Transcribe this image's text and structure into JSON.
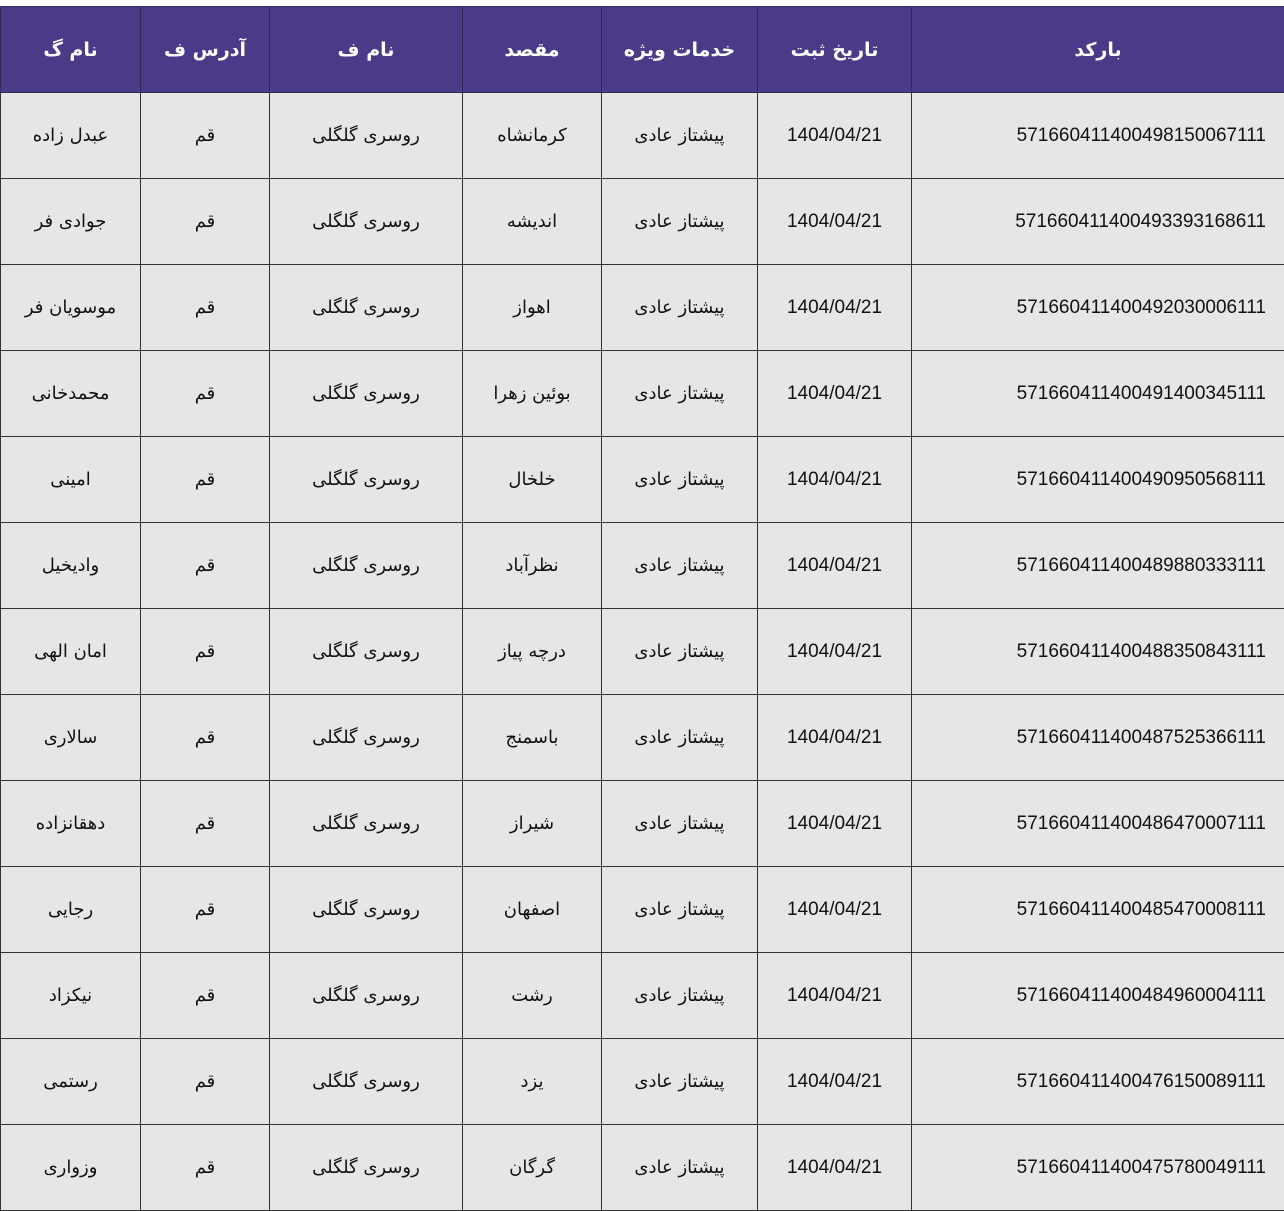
{
  "headers": {
    "barcode": "بارکد",
    "reg_date": "تاریخ ثبت",
    "service": "خدمات ویژه",
    "destination": "مقصد",
    "sender_name": "نام ف",
    "sender_address": "آدرس ف",
    "receiver_name": "نام گ"
  },
  "rows": [
    {
      "barcode": "571660411400498150067111",
      "reg_date": "1404/04/21",
      "service": "پیشتاز عادی",
      "destination": "کرمانشاه",
      "sender_name": "روسری گلگلی",
      "sender_address": "قم",
      "receiver_name": "عبدل زاده"
    },
    {
      "barcode": "571660411400493393168611",
      "reg_date": "1404/04/21",
      "service": "پیشتاز عادی",
      "destination": "اندیشه",
      "sender_name": "روسری گلگلی",
      "sender_address": "قم",
      "receiver_name": "جوادی فر"
    },
    {
      "barcode": "571660411400492030006111",
      "reg_date": "1404/04/21",
      "service": "پیشتاز عادی",
      "destination": "اهواز",
      "sender_name": "روسری گلگلی",
      "sender_address": "قم",
      "receiver_name": "موسویان فر"
    },
    {
      "barcode": "571660411400491400345111",
      "reg_date": "1404/04/21",
      "service": "پیشتاز عادی",
      "destination": "بوئین زهرا",
      "sender_name": "روسری گلگلی",
      "sender_address": "قم",
      "receiver_name": "محمدخانی"
    },
    {
      "barcode": "571660411400490950568111",
      "reg_date": "1404/04/21",
      "service": "پیشتاز عادی",
      "destination": "خلخال",
      "sender_name": "روسری گلگلی",
      "sender_address": "قم",
      "receiver_name": "امینی"
    },
    {
      "barcode": "571660411400489880333111",
      "reg_date": "1404/04/21",
      "service": "پیشتاز عادی",
      "destination": "نظرآباد",
      "sender_name": "روسری گلگلی",
      "sender_address": "قم",
      "receiver_name": "وادیخیل"
    },
    {
      "barcode": "571660411400488350843111",
      "reg_date": "1404/04/21",
      "service": "پیشتاز عادی",
      "destination": "درچه پیاز",
      "sender_name": "روسری گلگلی",
      "sender_address": "قم",
      "receiver_name": "امان الهی"
    },
    {
      "barcode": "571660411400487525366111",
      "reg_date": "1404/04/21",
      "service": "پیشتاز عادی",
      "destination": "باسمنج",
      "sender_name": "روسری گلگلی",
      "sender_address": "قم",
      "receiver_name": "سالاری"
    },
    {
      "barcode": "571660411400486470007111",
      "reg_date": "1404/04/21",
      "service": "پیشتاز عادی",
      "destination": "شیراز",
      "sender_name": "روسری گلگلی",
      "sender_address": "قم",
      "receiver_name": "دهقانزاده"
    },
    {
      "barcode": "571660411400485470008111",
      "reg_date": "1404/04/21",
      "service": "پیشتاز عادی",
      "destination": "اصفهان",
      "sender_name": "روسری گلگلی",
      "sender_address": "قم",
      "receiver_name": "رجایی"
    },
    {
      "barcode": "571660411400484960004111",
      "reg_date": "1404/04/21",
      "service": "پیشتاز عادی",
      "destination": "رشت",
      "sender_name": "روسری گلگلی",
      "sender_address": "قم",
      "receiver_name": "نیکزاد"
    },
    {
      "barcode": "571660411400476150089111",
      "reg_date": "1404/04/21",
      "service": "پیشتاز عادی",
      "destination": "یزد",
      "sender_name": "روسری گلگلی",
      "sender_address": "قم",
      "receiver_name": "رستمی"
    },
    {
      "barcode": "571660411400475780049111",
      "reg_date": "1404/04/21",
      "service": "پیشتاز عادی",
      "destination": "گرگان",
      "sender_name": "روسری گلگلی",
      "sender_address": "قم",
      "receiver_name": "وزواری"
    }
  ]
}
